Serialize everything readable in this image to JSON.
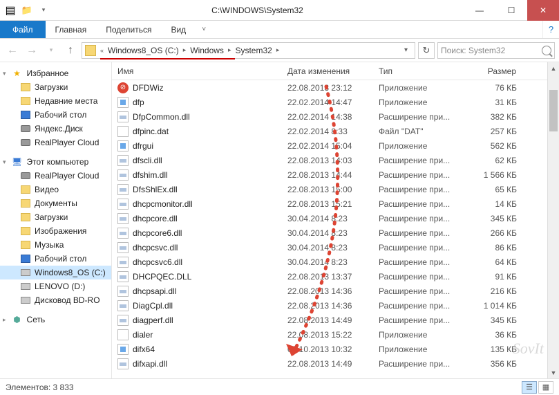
{
  "window": {
    "title": "C:\\WINDOWS\\System32"
  },
  "qat": {
    "properties": "▤",
    "new_folder": "📁",
    "dropdown": "▾"
  },
  "ribbon": {
    "file": "Файл",
    "tabs": [
      "Главная",
      "Поделиться",
      "Вид"
    ]
  },
  "nav": {
    "back": "←",
    "forward": "→",
    "recent": "▾",
    "up": "↑",
    "crumbs": [
      "«",
      "Windows8_OS (C:)",
      "Windows",
      "System32"
    ],
    "refresh": "↻",
    "search_placeholder": "Поиск: System32"
  },
  "sidebar": {
    "favorites": {
      "label": "Избранное",
      "items": [
        {
          "label": "Загрузки",
          "ico": "fold"
        },
        {
          "label": "Недавние места",
          "ico": "fold"
        },
        {
          "label": "Рабочий стол",
          "ico": "desk"
        },
        {
          "label": "Яндекс.Диск",
          "ico": "disk"
        },
        {
          "label": "RealPlayer Cloud",
          "ico": "disk"
        }
      ]
    },
    "computer": {
      "label": "Этот компьютер",
      "items": [
        {
          "label": "RealPlayer Cloud",
          "ico": "disk"
        },
        {
          "label": "Видео",
          "ico": "fold"
        },
        {
          "label": "Документы",
          "ico": "fold"
        },
        {
          "label": "Загрузки",
          "ico": "fold"
        },
        {
          "label": "Изображения",
          "ico": "fold"
        },
        {
          "label": "Музыка",
          "ico": "fold"
        },
        {
          "label": "Рабочий стол",
          "ico": "desk"
        },
        {
          "label": "Windows8_OS (C:)",
          "ico": "drive",
          "sel": true
        },
        {
          "label": "LENOVO (D:)",
          "ico": "drive"
        },
        {
          "label": "Дисковод BD-RO",
          "ico": "drive"
        }
      ]
    },
    "network": {
      "label": "Сеть"
    }
  },
  "columns": {
    "name": "Имя",
    "date": "Дата изменения",
    "type": "Тип",
    "size": "Размер"
  },
  "files": [
    {
      "ico": "red",
      "name": "DFDWiz",
      "date": "22.08.2013 23:12",
      "type": "Приложение",
      "size": "76 КБ"
    },
    {
      "ico": "app",
      "name": "dfp",
      "date": "22.02.2014 14:47",
      "type": "Приложение",
      "size": "31 КБ"
    },
    {
      "ico": "dll",
      "name": "DfpCommon.dll",
      "date": "22.02.2014 14:38",
      "type": "Расширение при...",
      "size": "382 КБ"
    },
    {
      "ico": "dat",
      "name": "dfpinc.dat",
      "date": "22.02.2014 8:33",
      "type": "Файл \"DAT\"",
      "size": "257 КБ"
    },
    {
      "ico": "app",
      "name": "dfrgui",
      "date": "22.02.2014 15:04",
      "type": "Приложение",
      "size": "562 КБ"
    },
    {
      "ico": "dll",
      "name": "dfscli.dll",
      "date": "22.08.2013 14:03",
      "type": "Расширение при...",
      "size": "62 КБ"
    },
    {
      "ico": "dll",
      "name": "dfshim.dll",
      "date": "22.08.2013 14:44",
      "type": "Расширение при...",
      "size": "1 566 КБ"
    },
    {
      "ico": "dll",
      "name": "DfsShlEx.dll",
      "date": "22.08.2013 15:00",
      "type": "Расширение при...",
      "size": "65 КБ"
    },
    {
      "ico": "dll",
      "name": "dhcpcmonitor.dll",
      "date": "22.08.2013 15:21",
      "type": "Расширение при...",
      "size": "14 КБ"
    },
    {
      "ico": "dll",
      "name": "dhcpcore.dll",
      "date": "30.04.2014 8:23",
      "type": "Расширение при...",
      "size": "345 КБ"
    },
    {
      "ico": "dll",
      "name": "dhcpcore6.dll",
      "date": "30.04.2014 8:23",
      "type": "Расширение при...",
      "size": "266 КБ"
    },
    {
      "ico": "dll",
      "name": "dhcpcsvc.dll",
      "date": "30.04.2014 8:23",
      "type": "Расширение при...",
      "size": "86 КБ"
    },
    {
      "ico": "dll",
      "name": "dhcpcsvc6.dll",
      "date": "30.04.2014 8:23",
      "type": "Расширение при...",
      "size": "64 КБ"
    },
    {
      "ico": "dll",
      "name": "DHCPQEC.DLL",
      "date": "22.08.2013 13:37",
      "type": "Расширение при...",
      "size": "91 КБ"
    },
    {
      "ico": "dll",
      "name": "dhcpsapi.dll",
      "date": "22.08.2013 14:36",
      "type": "Расширение при...",
      "size": "216 КБ"
    },
    {
      "ico": "dll",
      "name": "DiagCpl.dll",
      "date": "22.08.2013 14:36",
      "type": "Расширение при...",
      "size": "1 014 КБ"
    },
    {
      "ico": "dll",
      "name": "diagperf.dll",
      "date": "22.08.2013 14:49",
      "type": "Расширение при...",
      "size": "345 КБ"
    },
    {
      "ico": "phone",
      "name": "dialer",
      "date": "22.08.2013 15:22",
      "type": "Приложение",
      "size": "36 КБ"
    },
    {
      "ico": "app",
      "name": "difx64",
      "date": "05.10.2013 10:32",
      "type": "Приложение",
      "size": "135 КБ"
    },
    {
      "ico": "dll",
      "name": "difxapi.dll",
      "date": "22.08.2013 14:49",
      "type": "Расширение при...",
      "size": "356 КБ"
    }
  ],
  "status": {
    "count_label": "Элементов:",
    "count": "3 833"
  },
  "watermark": "SovIt"
}
